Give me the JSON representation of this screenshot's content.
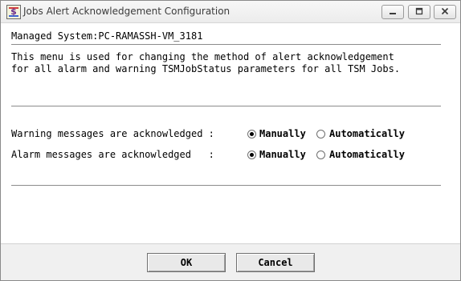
{
  "window": {
    "title": "Jobs Alert Acknowledgement Configuration",
    "icon": "app-icon",
    "controls": {
      "minimize": "minimize-icon",
      "maximize": "maximize-icon",
      "close": "close-icon"
    }
  },
  "managed_system": "Managed System:PC-RAMASSH-VM_3181",
  "description": [
    "This menu is used for changing the method of alert acknowledgement",
    "for all alarm and warning TSMJobStatus parameters for all TSM Jobs."
  ],
  "options": [
    {
      "label": "Warning messages are acknowledged :",
      "choices": [
        "Manually",
        "Automatically"
      ],
      "selected": "Manually"
    },
    {
      "label": "Alarm messages are acknowledged   :",
      "choices": [
        "Manually",
        "Automatically"
      ],
      "selected": "Manually"
    }
  ],
  "buttons": {
    "ok": "OK",
    "cancel": "Cancel"
  }
}
